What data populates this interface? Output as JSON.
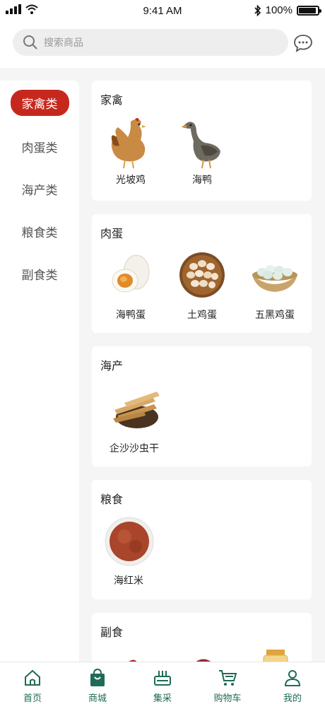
{
  "status_bar": {
    "time": "9:41 AM",
    "battery": "100%"
  },
  "search": {
    "placeholder": "搜索商品"
  },
  "sidebar": {
    "items": [
      {
        "label": "家禽类",
        "active": true
      },
      {
        "label": "肉蛋类",
        "active": false
      },
      {
        "label": "海产类",
        "active": false
      },
      {
        "label": "粮食类",
        "active": false
      },
      {
        "label": "副食类",
        "active": false
      }
    ]
  },
  "sections": [
    {
      "title": "家禽",
      "products": [
        {
          "name": "光坡鸡",
          "icon": "chicken"
        },
        {
          "name": "海鸭",
          "icon": "duck"
        }
      ]
    },
    {
      "title": "肉蛋",
      "products": [
        {
          "name": "海鸭蛋",
          "icon": "salted-egg"
        },
        {
          "name": "土鸡蛋",
          "icon": "egg-basket"
        },
        {
          "name": "五黑鸡蛋",
          "icon": "egg-bowl"
        }
      ]
    },
    {
      "title": "海产",
      "products": [
        {
          "name": "企沙沙虫干",
          "icon": "dried-sandworm"
        }
      ]
    },
    {
      "title": "粮食",
      "products": [
        {
          "name": "海红米",
          "icon": "red-rice"
        }
      ]
    },
    {
      "title": "副食",
      "products": [
        {
          "name": "",
          "icon": "chili"
        },
        {
          "name": "",
          "icon": "sweet-potato"
        },
        {
          "name": "",
          "icon": "jar"
        }
      ]
    }
  ],
  "tabbar": {
    "items": [
      {
        "label": "首页",
        "icon": "home-icon"
      },
      {
        "label": "商城",
        "icon": "shopping-bag-icon"
      },
      {
        "label": "集采",
        "icon": "basket-icon"
      },
      {
        "label": "购物车",
        "icon": "cart-icon"
      },
      {
        "label": "我的",
        "icon": "user-icon"
      }
    ]
  },
  "colors": {
    "accent": "#c7281e",
    "tab": "#1f6b57"
  }
}
